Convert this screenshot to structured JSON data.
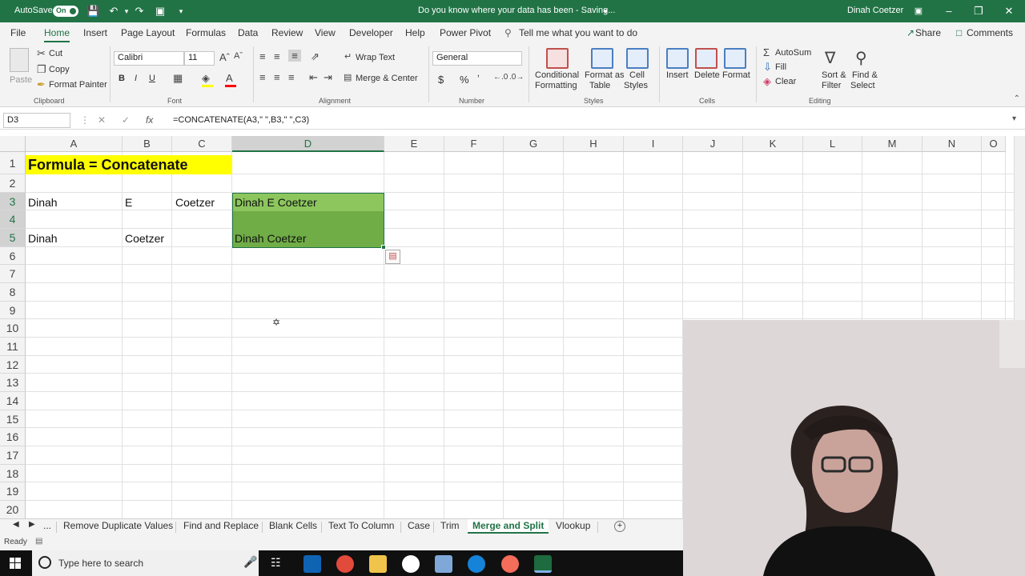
{
  "title_bar": {
    "autosave_label": "AutoSave",
    "autosave_state": "On",
    "doc_title": "Do you know where your data has been  -  Saving...",
    "user_name": "Dinah Coetzer"
  },
  "menu": {
    "tabs": [
      "File",
      "Home",
      "Insert",
      "Page Layout",
      "Formulas",
      "Data",
      "Review",
      "View",
      "Developer",
      "Help",
      "Power Pivot"
    ],
    "active_tab": "Home",
    "tell_me": "Tell me what you want to do",
    "share": "Share",
    "comments": "Comments"
  },
  "ribbon": {
    "clipboard": {
      "paste": "Paste",
      "cut": "Cut",
      "copy": "Copy",
      "format_painter": "Format Painter",
      "group": "Clipboard"
    },
    "font": {
      "name": "Calibri",
      "size": "11",
      "group": "Font",
      "bold": "B",
      "italic": "I",
      "underline": "U",
      "font_color": "#ff0000",
      "fill_color": "#ffff00"
    },
    "alignment": {
      "wrap": "Wrap Text",
      "merge": "Merge & Center",
      "group": "Alignment"
    },
    "number": {
      "format": "General",
      "group": "Number",
      "currency": "$",
      "percent": "%"
    },
    "styles": {
      "conditional": "Conditional",
      "conditional2": "Formatting",
      "format_as": "Format as",
      "format_as2": "Table",
      "cell": "Cell",
      "cell2": "Styles",
      "group": "Styles"
    },
    "cells": {
      "insert": "Insert",
      "delete": "Delete",
      "format": "Format",
      "group": "Cells"
    },
    "editing": {
      "autosum": "AutoSum",
      "fill": "Fill",
      "clear": "Clear",
      "sort": "Sort &",
      "sort2": "Filter",
      "find": "Find &",
      "find2": "Select",
      "group": "Editing"
    }
  },
  "formula_bar": {
    "name_box": "D3",
    "formula": "=CONCATENATE(A3,\" \",B3,\" \",C3)"
  },
  "grid": {
    "columns": [
      "A",
      "B",
      "C",
      "D",
      "E",
      "F",
      "G",
      "H",
      "I",
      "J",
      "K",
      "L",
      "M",
      "N",
      "O"
    ],
    "rows": [
      "1",
      "2",
      "3",
      "4",
      "5",
      "6",
      "7",
      "8",
      "9",
      "10",
      "11",
      "12",
      "13",
      "14",
      "15",
      "16",
      "17",
      "18",
      "19",
      "20"
    ],
    "selected_col": "D",
    "cells": {
      "A1": "Formula = Concatenate",
      "A3": "Dinah",
      "B3": "E",
      "C3": "Coetzer",
      "D3": "Dinah E Coetzer",
      "A5": "Dinah",
      "B5": "Coetzer",
      "D5": "Dinah Coetzer"
    },
    "highlight_color": "#ffff00",
    "selection_color": "#70ad47"
  },
  "sheet_tabs": {
    "ellipsis": "...",
    "tabs": [
      "Remove Duplicate Values",
      "Find and Replace",
      "Blank Cells",
      "Text To Column",
      "Case",
      "Trim",
      "Merge and Split",
      "Vlookup"
    ],
    "active": "Merge and Split"
  },
  "status": {
    "ready": "Ready"
  },
  "taskbar": {
    "search_placeholder": "Type here to search"
  }
}
